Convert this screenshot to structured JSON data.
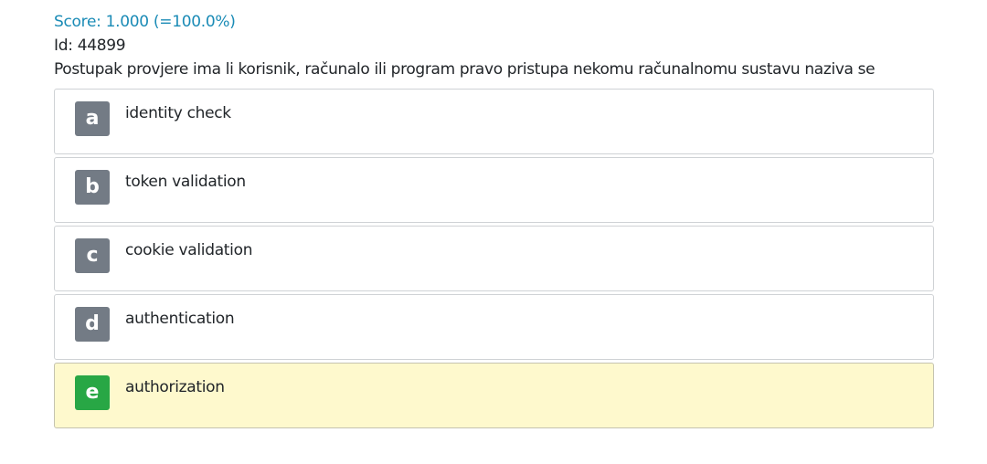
{
  "header": {
    "score": "Score: 1.000 (=100.0%)",
    "id": "Id: 44899",
    "question": "Postupak provjere ima li korisnik, računalo ili program pravo pristupa nekomu računalnomu sustavu naziva se"
  },
  "answers": [
    {
      "letter": "a",
      "text": "identity check",
      "selected": false
    },
    {
      "letter": "b",
      "text": "token validation",
      "selected": false
    },
    {
      "letter": "c",
      "text": "cookie validation",
      "selected": false
    },
    {
      "letter": "d",
      "text": "authentication",
      "selected": false
    },
    {
      "letter": "e",
      "text": "authorization",
      "selected": true
    }
  ],
  "colors": {
    "score_text": "#1a8bb6",
    "letter_default": "#737b85",
    "letter_correct": "#28a745",
    "selected_background": "#fef9cd"
  }
}
